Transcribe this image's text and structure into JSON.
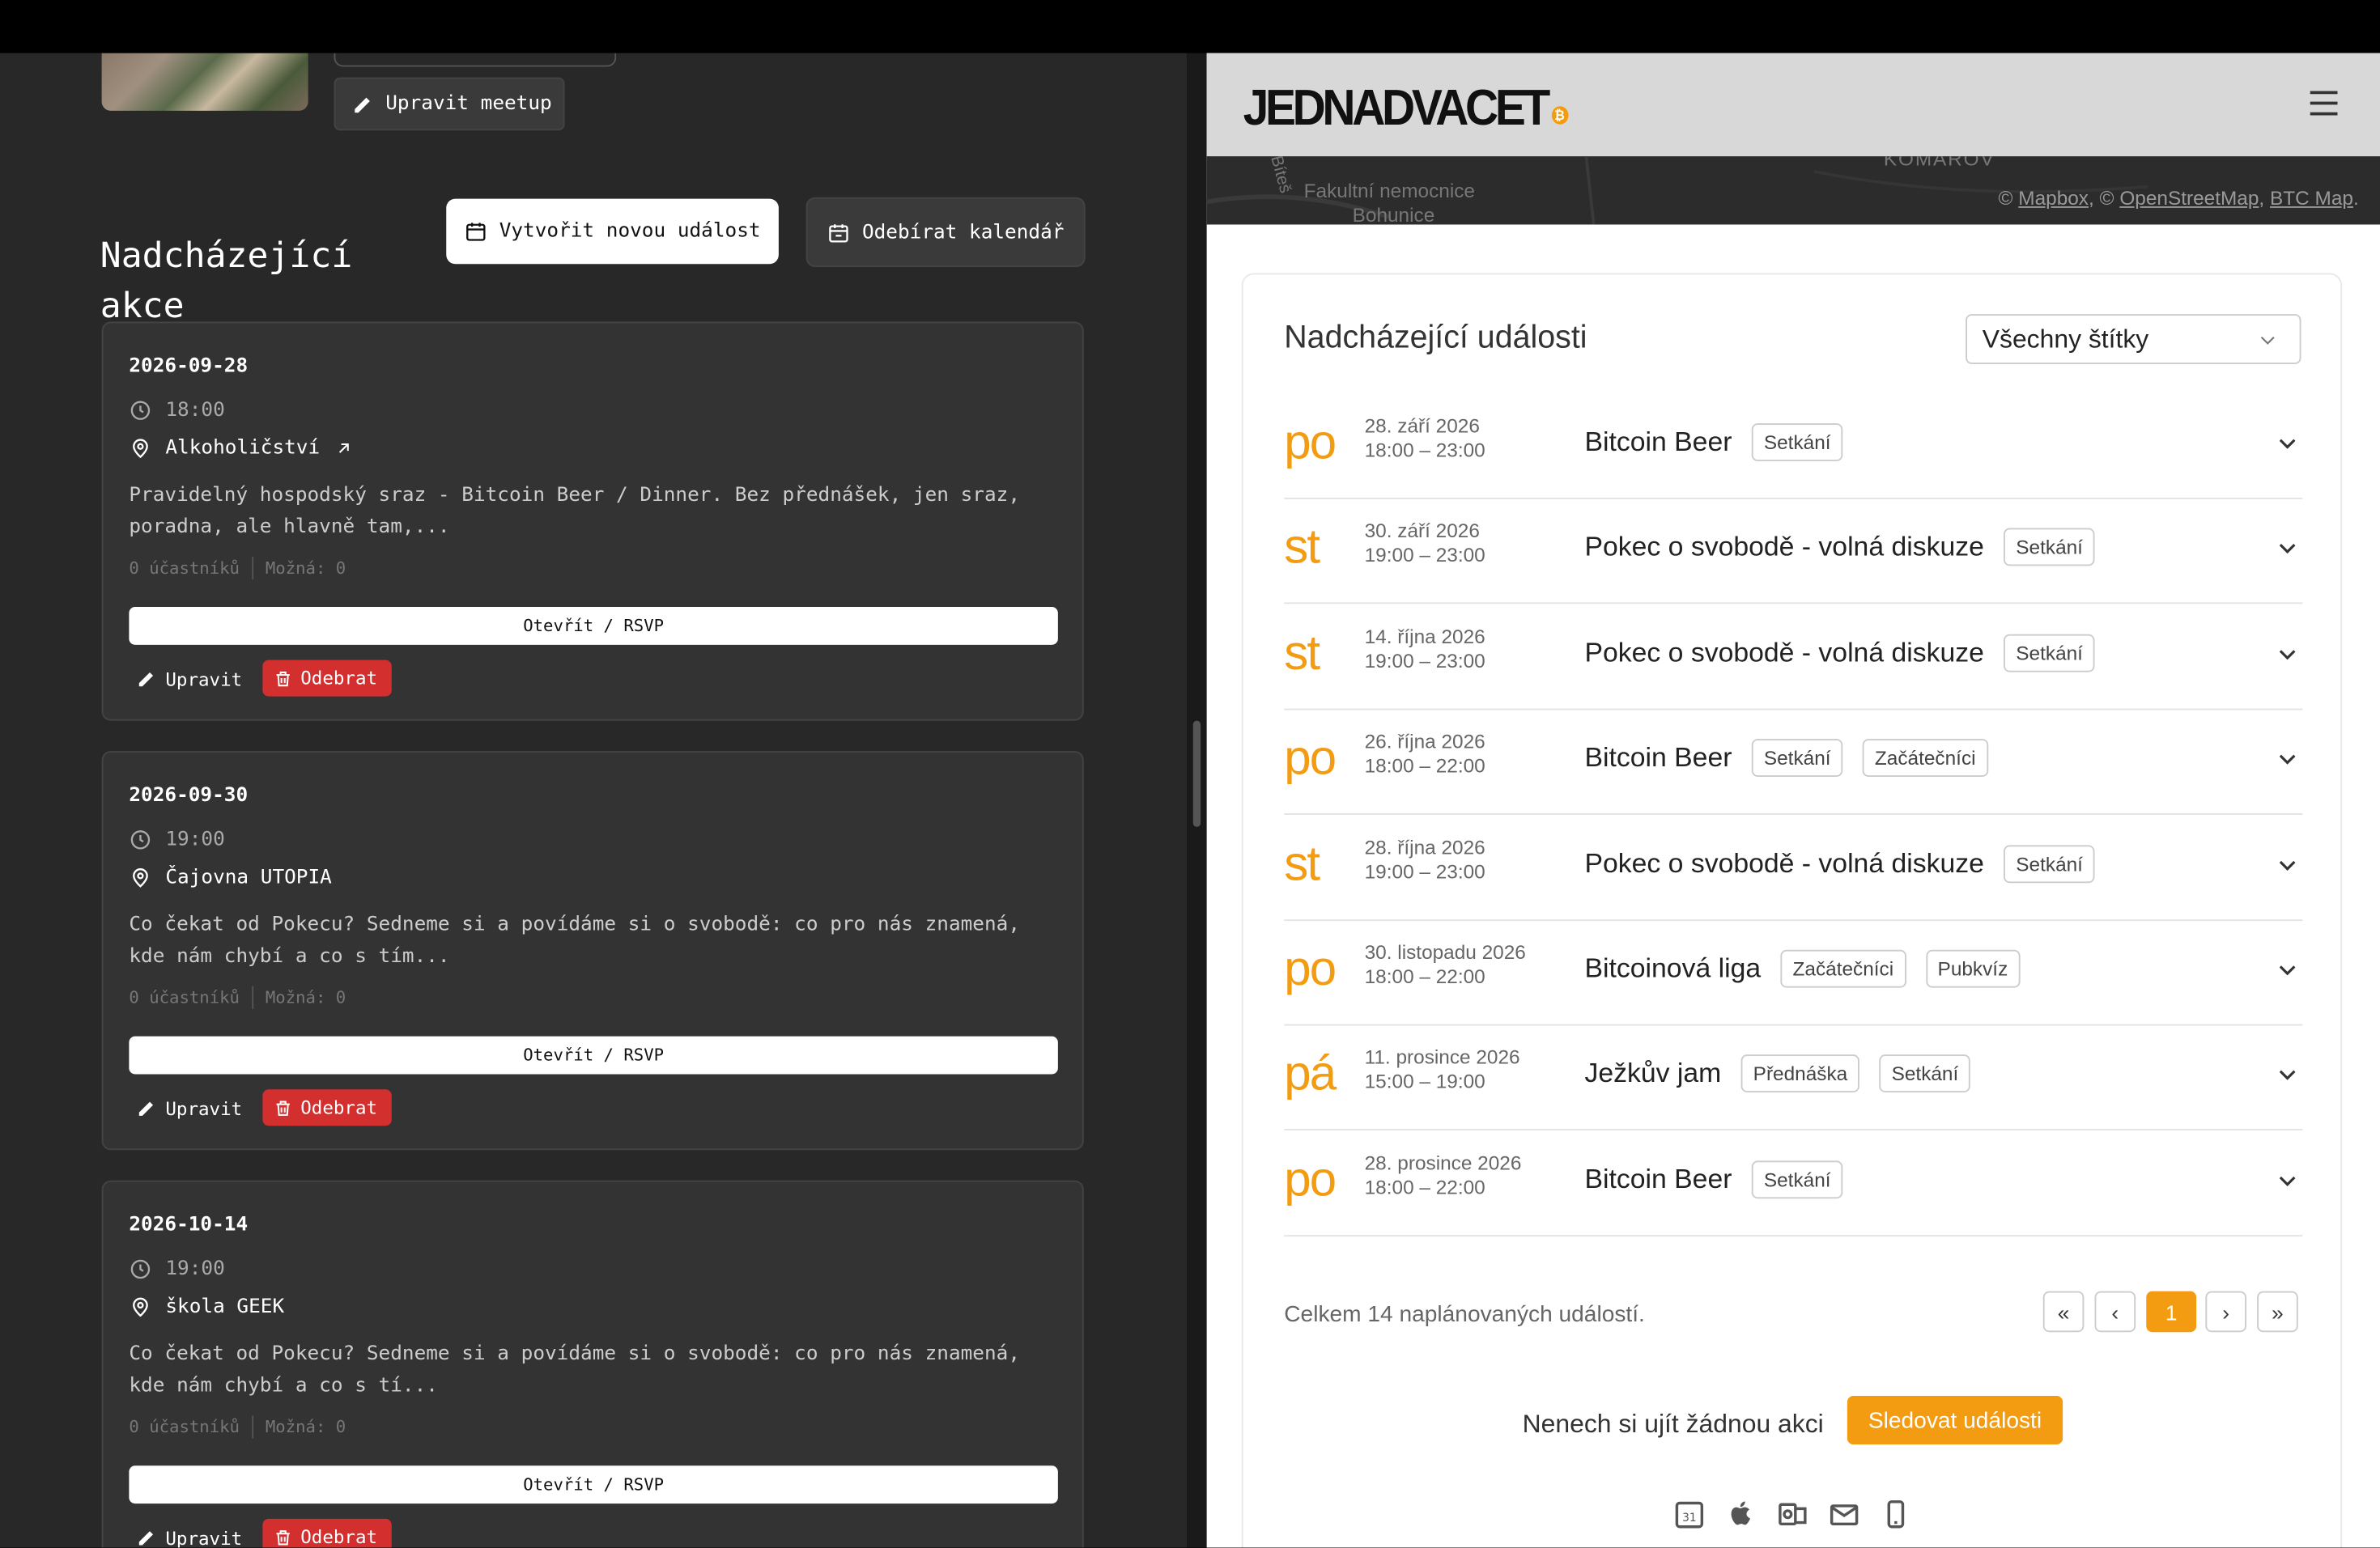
{
  "left": {
    "edit_meetup_label": "Upravit meetup",
    "section_title": "Nadcházející akce",
    "create_event_label": "Vytvořit novou událost",
    "subscribe_calendar_label": "Odebírat kalendář",
    "events": [
      {
        "date": "2026-09-28",
        "time": "18:00",
        "location": "Alkoholičství",
        "description": "Pravidelný hospodský sraz - Bitcoin Beer / Dinner. Bez přednášek, jen sraz, poradna, ale hlavně tam,...",
        "participants": "0 účastníků",
        "maybe": "Možná: 0",
        "open_label": "Otevřít / RSVP",
        "edit_label": "Upravit",
        "remove_label": "Odebrat"
      },
      {
        "date": "2026-09-30",
        "time": "19:00",
        "location": "Čajovna UTOPIA",
        "description": "Co čekat od Pokecu? Sedneme si a povídáme si o svobodě: co pro nás znamená, kde nám chybí a co s tím...",
        "participants": "0 účastníků",
        "maybe": "Možná: 0",
        "open_label": "Otevřít / RSVP",
        "edit_label": "Upravit",
        "remove_label": "Odebrat"
      },
      {
        "date": "2026-10-14",
        "time": "19:00",
        "location": "škola GEEK",
        "description": "Co čekat od Pokecu? Sedneme si a povídáme si o svobodě: co pro nás znamená, kde nám chybí a co s tí...",
        "participants": "0 účastníků",
        "maybe": "Možná: 0",
        "open_label": "Otevřít / RSVP",
        "edit_label": "Upravit",
        "remove_label": "Odebrat"
      }
    ]
  },
  "right": {
    "logo": "JEDNADVACET",
    "map": {
      "labels": [
        "Fakultní nemocnice",
        "Bohunice",
        "KOMÁROV",
        "Bíteš"
      ],
      "attribution_prefix": "©",
      "attribution_mapbox": "Mapbox",
      "attribution_sep1": ", ©",
      "attribution_osm": "OpenStreetMap",
      "attribution_sep2": ",",
      "attribution_btc": "BTC Map",
      "attribution_end": "."
    },
    "panel_title": "Nadcházející události",
    "filter_value": "Všechny štítky",
    "events": [
      {
        "day": "po",
        "date": "28. září 2026",
        "time": "18:00 – 23:00",
        "title": "Bitcoin Beer",
        "tags": [
          "Setkání"
        ]
      },
      {
        "day": "st",
        "date": "30. září 2026",
        "time": "19:00 – 23:00",
        "title": "Pokec o svobodě - volná diskuze",
        "tags": [
          "Setkání"
        ]
      },
      {
        "day": "st",
        "date": "14. října 2026",
        "time": "19:00 – 23:00",
        "title": "Pokec o svobodě - volná diskuze",
        "tags": [
          "Setkání"
        ]
      },
      {
        "day": "po",
        "date": "26. října 2026",
        "time": "18:00 – 22:00",
        "title": "Bitcoin Beer",
        "tags": [
          "Setkání",
          "Začátečníci"
        ]
      },
      {
        "day": "st",
        "date": "28. října 2026",
        "time": "19:00 – 23:00",
        "title": "Pokec o svobodě - volná diskuze",
        "tags": [
          "Setkání"
        ]
      },
      {
        "day": "po",
        "date": "30. listopadu 2026",
        "time": "18:00 – 22:00",
        "title": "Bitcoinová liga",
        "tags": [
          "Začátečníci",
          "Pubkvíz"
        ]
      },
      {
        "day": "pá",
        "date": "11. prosince 2026",
        "time": "15:00 – 19:00",
        "title": "Ježkův jam",
        "tags": [
          "Přednáška",
          "Setkání"
        ]
      },
      {
        "day": "po",
        "date": "28. prosince 2026",
        "time": "18:00 – 22:00",
        "title": "Bitcoin Beer",
        "tags": [
          "Setkání"
        ]
      }
    ],
    "total_text": "Celkem 14 naplánovaných událostí.",
    "pagination": {
      "first": "«",
      "prev": "‹",
      "current": "1",
      "next": "›",
      "last": "»"
    },
    "follow_text": "Nenech si ujít žádnou akci",
    "follow_button": "Sledovat události",
    "calendar_icons": [
      "google-calendar-icon",
      "apple-icon",
      "outlook-icon",
      "mail-icon",
      "phone-icon"
    ]
  },
  "colors": {
    "accent": "#f39c12",
    "danger": "#d32f2f",
    "left_bg": "#282828",
    "card_bg": "#333333"
  }
}
